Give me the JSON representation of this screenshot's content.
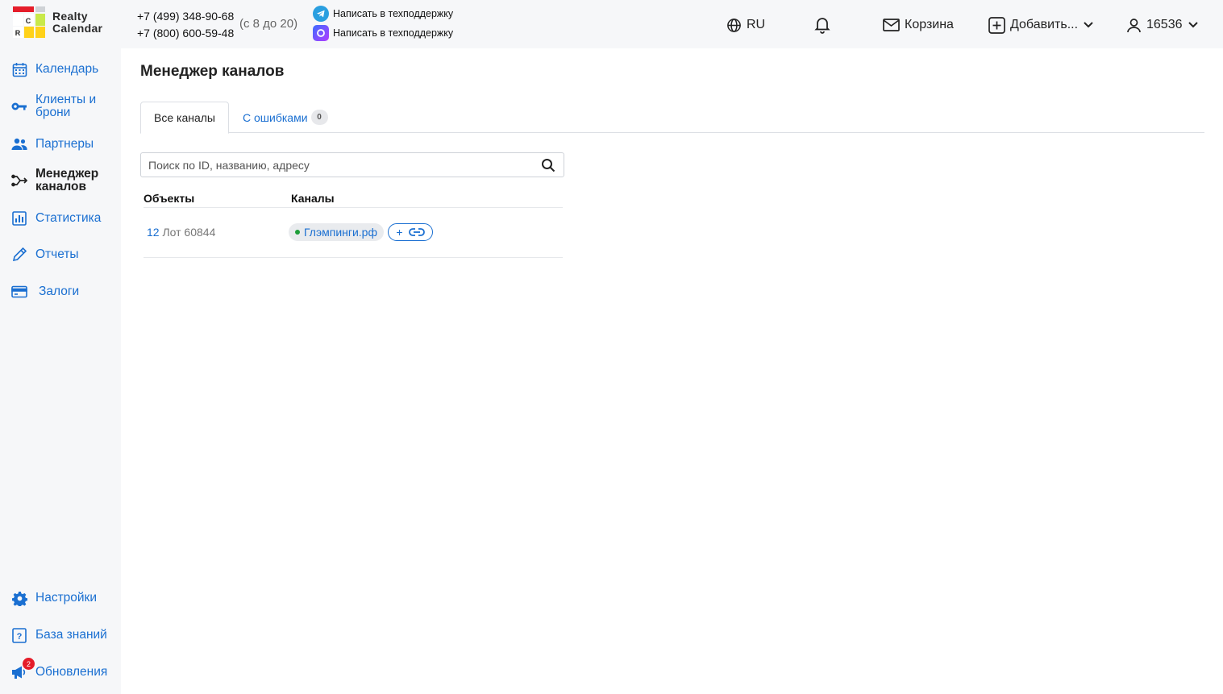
{
  "brand": {
    "name_line1": "Realty",
    "name_line2": "Calendar"
  },
  "header": {
    "phone1": "+7 (499) 348-90-68",
    "phone2": "+7 (800) 600-59-48",
    "hours": "(с 8 до 20)",
    "support_telegram": "Написать в техподдержку",
    "support_max": "Написать в техподдержку",
    "language": "RU",
    "cart": "Корзина",
    "add": "Добавить...",
    "account": "16536"
  },
  "sidebar": {
    "items": [
      {
        "label": "Календарь",
        "icon": "calendar-icon"
      },
      {
        "label": "Клиенты и брони",
        "icon": "key-icon"
      },
      {
        "label": "Партнеры",
        "icon": "people-icon"
      },
      {
        "label": "Менеджер каналов",
        "icon": "channels-icon",
        "active": true
      },
      {
        "label": "Статистика",
        "icon": "chart-icon"
      },
      {
        "label": "Отчеты",
        "icon": "pencil-icon"
      },
      {
        "label": "Залоги",
        "icon": "card-icon"
      }
    ],
    "bottom": [
      {
        "label": "Настройки",
        "icon": "gear-icon"
      },
      {
        "label": "База знаний",
        "icon": "question-icon"
      },
      {
        "label": "Обновления",
        "icon": "megaphone-icon",
        "badge": "2"
      }
    ]
  },
  "main": {
    "title": "Менеджер каналов",
    "tabs": [
      {
        "label": "Все каналы",
        "active": true
      },
      {
        "label": "С ошибками",
        "count": "0"
      }
    ],
    "search_placeholder": "Поиск по ID, названию, адресу",
    "columns": {
      "objects": "Объекты",
      "channels": "Каналы"
    },
    "rows": [
      {
        "object_id": "12",
        "object_name": "Лот 60844",
        "channel": "Глэмпинги.рф",
        "channel_status_color": "#1e9e3a",
        "add_label": "+"
      }
    ]
  },
  "colors": {
    "accent": "#1a6fd1",
    "badge": "#e51d2a",
    "sidebar_bg": "#f6f7f9"
  }
}
